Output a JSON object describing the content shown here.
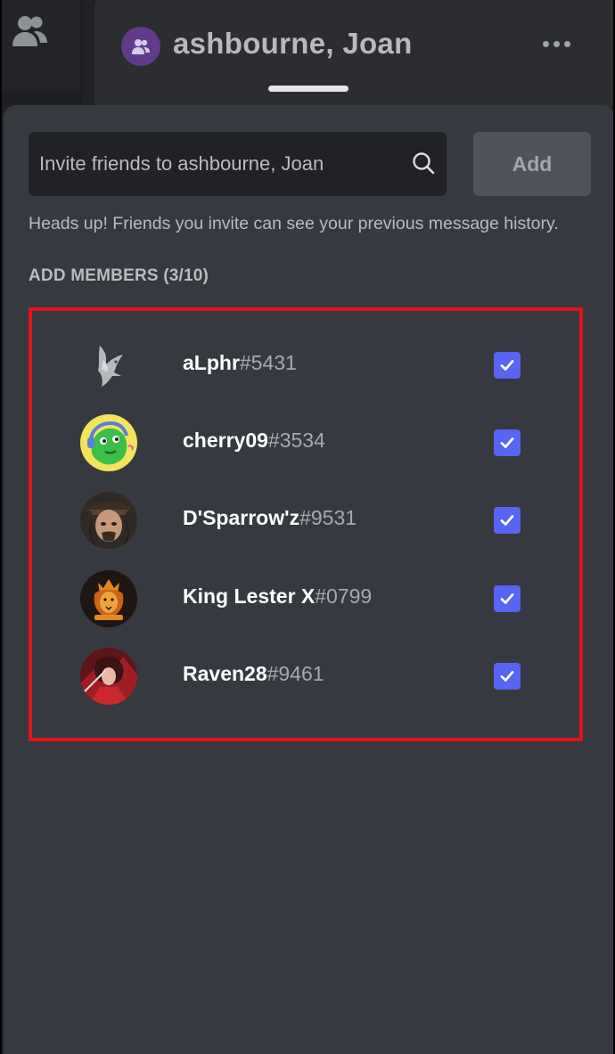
{
  "channel": {
    "title": "ashbourne, Joan",
    "avatar_icon": "group-icon",
    "menu_icon": "more-horizontal-icon"
  },
  "rail": {
    "friends_icon": "friends-icon"
  },
  "invite": {
    "search_placeholder": "Invite friends to ashbourne, Joan",
    "search_icon": "search-icon",
    "add_label": "Add",
    "hint": "Heads up! Friends you invite can see your previous message history."
  },
  "members": {
    "title": "ADD MEMBERS (3/10)",
    "items": [
      {
        "username": "aLphr",
        "discriminator": "#5431",
        "checked": true,
        "avatar": "bird-avatar"
      },
      {
        "username": "cherry09",
        "discriminator": "#3534",
        "checked": true,
        "avatar": "cartoon-avatar"
      },
      {
        "username": "D'Sparrow'z",
        "discriminator": "#9531",
        "checked": true,
        "avatar": "pirate-avatar"
      },
      {
        "username": "King Lester X",
        "discriminator": "#0799",
        "checked": true,
        "avatar": "lion-logo-avatar"
      },
      {
        "username": "Raven28",
        "discriminator": "#9461",
        "checked": true,
        "avatar": "anime-avatar"
      }
    ]
  },
  "colors": {
    "accent": "#5865f2",
    "highlight_border": "#e3131b",
    "sheet_bg": "#36393f",
    "input_bg": "#202225"
  }
}
